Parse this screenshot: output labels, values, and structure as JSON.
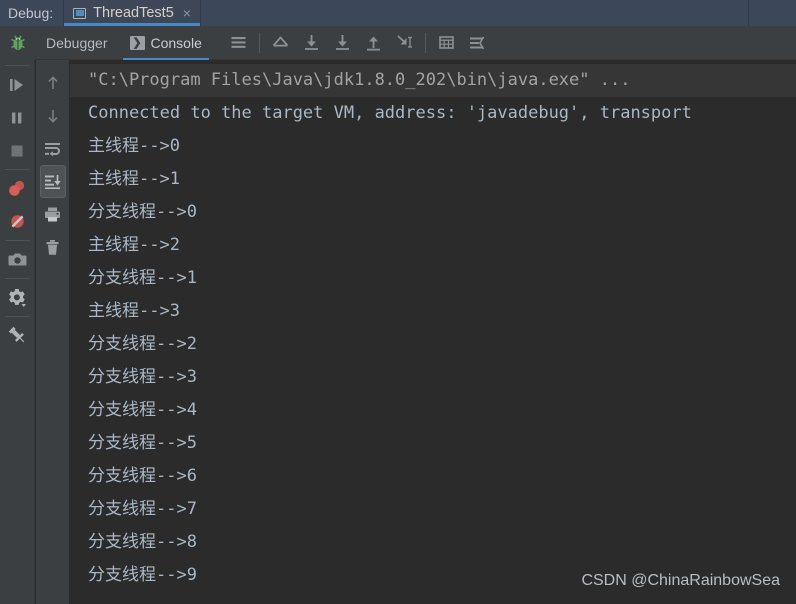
{
  "window": {
    "debug_label": "Debug:",
    "accent_color": "#4a88c7",
    "tabbar_bg": "#3c4759",
    "toolbar_bg": "#3c3f41",
    "console_bg": "#2b2b2b",
    "console_text_color": "#a9b7c6"
  },
  "tabs": [
    {
      "label": "ThreadTest5",
      "icon": "run-configuration-icon",
      "close": "×",
      "active": true
    }
  ],
  "toolbar": {
    "tabs": [
      {
        "label": "Debugger",
        "icon": null,
        "active": false
      },
      {
        "label": "Console",
        "icon": "console-icon",
        "glyph": "❯",
        "active": true
      }
    ],
    "actions": [
      {
        "name": "view-breakpoints-icon",
        "title": "View Breakpoints"
      },
      {
        "name": "step-out-icon",
        "title": "Step Out"
      },
      {
        "name": "step-over-icon",
        "title": "Step Over"
      },
      {
        "name": "step-into-icon",
        "title": "Step Into"
      },
      {
        "name": "force-step-into-icon",
        "title": "Force Step Into"
      },
      {
        "name": "run-to-cursor-icon",
        "title": "Run to Cursor"
      },
      {
        "name": "evaluate-expression-icon",
        "title": "Evaluate Expression"
      },
      {
        "name": "settings-layout-icon",
        "title": "Layout Settings"
      }
    ]
  },
  "rail": {
    "items": [
      {
        "name": "debug-icon",
        "title": "Debug"
      },
      {
        "name": "resume-program-icon",
        "title": "Resume Program"
      },
      {
        "name": "pause-program-icon",
        "title": "Pause Program"
      },
      {
        "name": "stop-icon",
        "title": "Stop"
      },
      {
        "name": "view-breakpoints-icon",
        "title": "View Breakpoints"
      },
      {
        "name": "mute-breakpoints-icon",
        "title": "Mute Breakpoints"
      },
      {
        "name": "screenshot-icon",
        "title": "Get Thread Dump"
      },
      {
        "name": "settings-gear-icon",
        "title": "Settings"
      },
      {
        "name": "pin-icon",
        "title": "Pin Tab"
      }
    ]
  },
  "console_rail": {
    "items": [
      {
        "name": "scroll-up-icon",
        "title": "Up the Stack Trace",
        "selected": false
      },
      {
        "name": "scroll-down-icon",
        "title": "Down the Stack Trace",
        "selected": false
      },
      {
        "name": "soft-wrap-icon",
        "title": "Use Soft Wraps",
        "selected": false
      },
      {
        "name": "scroll-to-end-icon",
        "title": "Scroll to the End",
        "selected": true
      },
      {
        "name": "print-icon",
        "title": "Print"
      },
      {
        "name": "clear-all-icon",
        "title": "Clear All"
      }
    ]
  },
  "console": {
    "lines": [
      {
        "text": "\"C:\\Program Files\\Java\\jdk1.8.0_202\\bin\\java.exe\" ...",
        "style": "cmdline"
      },
      {
        "text": "Connected to the target VM, address: 'javadebug', transport",
        "style": "sysline"
      },
      {
        "text": "主线程-->0",
        "style": "out"
      },
      {
        "text": "主线程-->1",
        "style": "out"
      },
      {
        "text": "分支线程-->0",
        "style": "out"
      },
      {
        "text": "主线程-->2",
        "style": "out"
      },
      {
        "text": "分支线程-->1",
        "style": "out"
      },
      {
        "text": "主线程-->3",
        "style": "out"
      },
      {
        "text": "分支线程-->2",
        "style": "out"
      },
      {
        "text": "分支线程-->3",
        "style": "out"
      },
      {
        "text": "分支线程-->4",
        "style": "out"
      },
      {
        "text": "分支线程-->5",
        "style": "out"
      },
      {
        "text": "分支线程-->6",
        "style": "out"
      },
      {
        "text": "分支线程-->7",
        "style": "out"
      },
      {
        "text": "分支线程-->8",
        "style": "out"
      },
      {
        "text": "分支线程-->9",
        "style": "out"
      }
    ]
  },
  "watermark": {
    "text": "CSDN @ChinaRainbowSea"
  }
}
